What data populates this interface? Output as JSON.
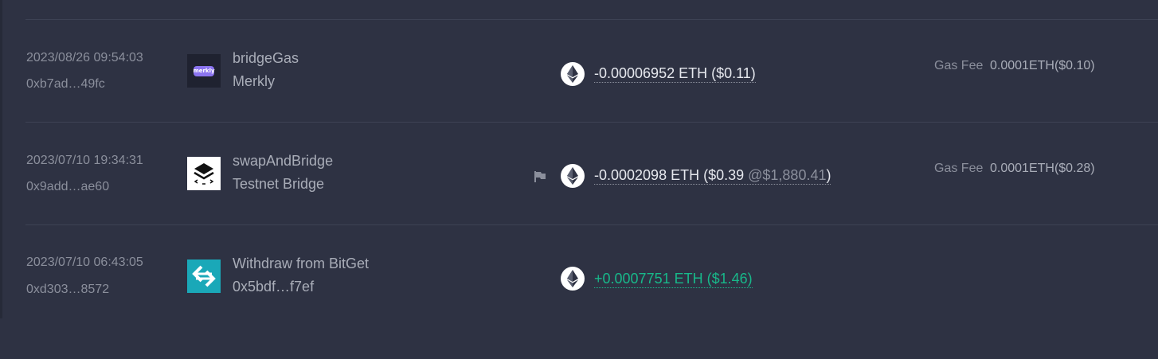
{
  "transactions": [
    {
      "time": "2023/08/26 09:54:03",
      "hash": "0xb7ad…49fc",
      "logo_icon": "merkly-logo",
      "logo_text": "merkly",
      "method": "bridgeGas",
      "subtitle": "Merkly",
      "flagged": false,
      "amount": "-0.00006952 ETH ($0.11)",
      "amount_price": "",
      "amount_suffix": "",
      "direction": "out",
      "gas_label": "Gas Fee",
      "gas_value": "0.0001ETH($0.10)"
    },
    {
      "time": "2023/07/10 19:34:31",
      "hash": "0x9add…ae60",
      "logo_icon": "testnet-bridge-logo",
      "method": "swapAndBridge",
      "subtitle": "Testnet Bridge",
      "flagged": true,
      "amount": "-0.0002098 ETH ($0.39 ",
      "amount_price": "@$1,880.41",
      "amount_suffix": ")",
      "direction": "out",
      "gas_label": "Gas Fee",
      "gas_value": "0.0001ETH($0.28)"
    },
    {
      "time": "2023/07/10 06:43:05",
      "hash": "0xd303…8572",
      "logo_icon": "bitget-logo",
      "method": "Withdraw from BitGet",
      "subtitle": "0x5bdf…f7ef",
      "flagged": false,
      "amount": "+0.0007751 ETH ($1.46)",
      "amount_price": "",
      "amount_suffix": "",
      "direction": "in",
      "gas_label": "",
      "gas_value": ""
    }
  ],
  "colors": {
    "background": "#2e3243",
    "divider": "#3d4254",
    "muted_text": "#8b8f9c",
    "negative_amount": "#e6e8ee",
    "positive_amount": "#18b88a",
    "bitget_brand": "#1aa8b8",
    "merkly_brand": "#8b74f0"
  },
  "icons": {
    "token": "ethereum-icon",
    "flag": "flag-icon"
  }
}
